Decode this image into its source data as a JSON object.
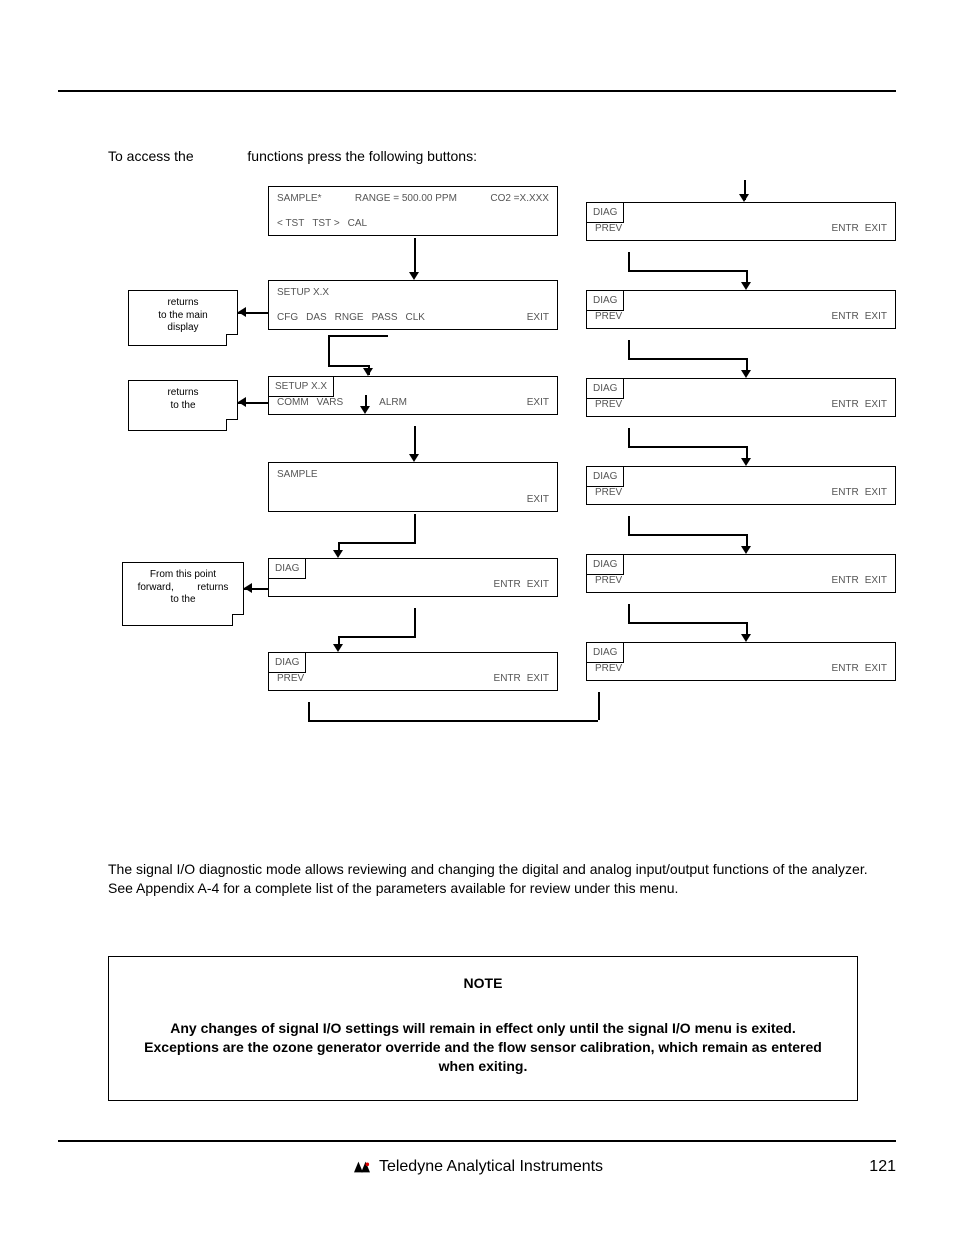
{
  "intro": {
    "before": "To access the",
    "after": "functions press the following buttons:"
  },
  "callouts": {
    "c1": {
      "l1": "returns",
      "l2": "to the main",
      "l3": "display"
    },
    "c2": {
      "l1": "returns",
      "l2": "to the"
    },
    "c3": {
      "l1": "From this point",
      "l2": "forward,",
      "l2b": "returns",
      "l3": "to the"
    }
  },
  "screens": {
    "s1": {
      "title": "SAMPLE*",
      "mid": "RANGE = 500.00 PPM",
      "right": "CO2 =X.XXX",
      "b1": "< TST",
      "b2": "TST >",
      "b3": "CAL"
    },
    "s2": {
      "title": "SETUP X.X",
      "b1": "CFG",
      "b2": "DAS",
      "b3": "RNGE",
      "b4": "PASS",
      "b5": "CLK",
      "exit": "EXIT"
    },
    "s3": {
      "title": "SETUP X.X",
      "b1": "COMM",
      "b2": "VARS",
      "b3": "ALRM",
      "exit": "EXIT"
    },
    "s4": {
      "title": "SAMPLE",
      "exit": "EXIT"
    },
    "s5": {
      "title": "DIAG",
      "entr": "ENTR",
      "exit": "EXIT"
    },
    "s6": {
      "title": "DIAG",
      "prev": "PREV",
      "entr": "ENTR",
      "exit": "EXIT"
    },
    "r1": {
      "title": "DIAG",
      "prev": "PREV",
      "entr": "ENTR",
      "exit": "EXIT"
    },
    "r2": {
      "title": "DIAG",
      "prev": "PREV",
      "entr": "ENTR",
      "exit": "EXIT"
    },
    "r3": {
      "title": "DIAG",
      "prev": "PREV",
      "entr": "ENTR",
      "exit": "EXIT"
    },
    "r4": {
      "title": "DIAG",
      "prev": "PREV",
      "entr": "ENTR",
      "exit": "EXIT"
    },
    "r5": {
      "title": "DIAG",
      "prev": "PREV",
      "entr": "ENTR",
      "exit": "EXIT"
    },
    "r6": {
      "title": "DIAG",
      "prev": "PREV",
      "entr": "ENTR",
      "exit": "EXIT"
    }
  },
  "sig_body": "The signal I/O diagnostic mode allows reviewing and changing the digital and analog input/output functions of the analyzer.  See Appendix A-4 for a complete list of the parameters available for review under this menu.",
  "note": {
    "title": "NOTE",
    "body": "Any changes of signal I/O settings will remain in effect only until the signal I/O menu is exited.  Exceptions are the ozone generator override and the flow sensor calibration, which remain as entered when exiting."
  },
  "footer": {
    "brand": "Teledyne Analytical Instruments",
    "page": "121"
  }
}
